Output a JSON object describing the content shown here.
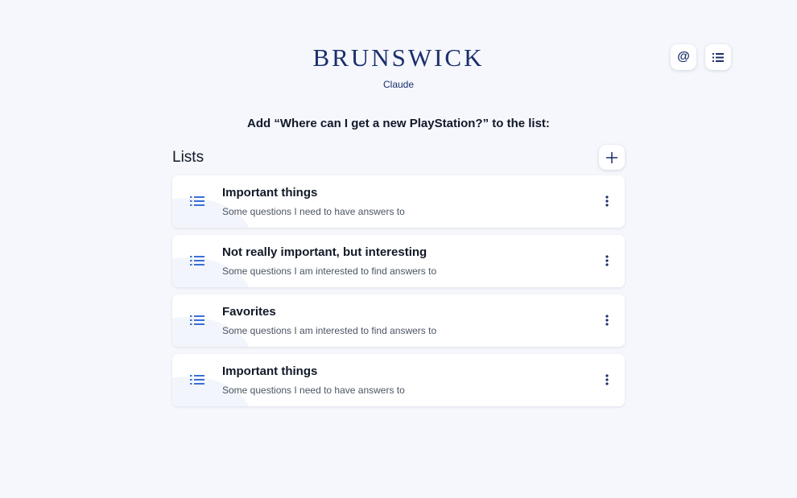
{
  "brand": {
    "title": "BRUNSWICK",
    "subtitle": "Claude"
  },
  "header_actions": [
    {
      "name": "mention-button",
      "icon": "at-icon"
    },
    {
      "name": "lists-button",
      "icon": "list-icon"
    }
  ],
  "prompt": "Add “Where can I get a new PlayStation?” to the list:",
  "lists": {
    "title": "Lists",
    "add_icon": "plus-icon",
    "items": [
      {
        "title": "Important things",
        "description": "Some questions I need to have answers to"
      },
      {
        "title": "Not really important, but interesting",
        "description": "Some questions I am interested to find answers to"
      },
      {
        "title": "Favorites",
        "description": "Some questions I am interested to find answers to"
      },
      {
        "title": "Important things",
        "description": "Some questions I need to have answers to"
      }
    ]
  },
  "colors": {
    "brand": "#1b2f6b",
    "accent": "#3b6fd4",
    "background": "#f5f7fc"
  }
}
